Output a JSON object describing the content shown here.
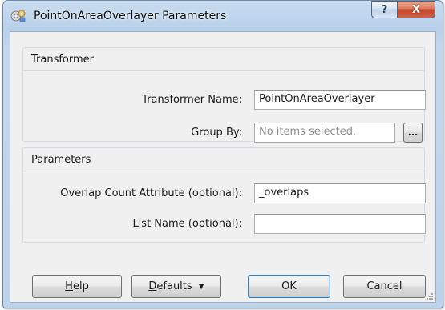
{
  "window": {
    "title": "PointOnAreaOverlayer Parameters",
    "help_caption": "?",
    "close_caption": "X"
  },
  "transformer_group": {
    "title": "Transformer",
    "name_label": "Transformer Name:",
    "name_value": "PointOnAreaOverlayer",
    "group_by_label": "Group By:",
    "group_by_placeholder": "No items selected.",
    "group_by_button": "..."
  },
  "parameters_group": {
    "title": "Parameters",
    "overlap_label": "Overlap Count Attribute (optional):",
    "overlap_value": "_overlaps",
    "list_name_label": "List Name (optional):",
    "list_name_value": ""
  },
  "buttons": {
    "help_first": "H",
    "help_rest": "elp",
    "defaults_first": "D",
    "defaults_rest": "efaults",
    "defaults_arrow": "▼",
    "ok": "OK",
    "cancel": "Cancel"
  }
}
